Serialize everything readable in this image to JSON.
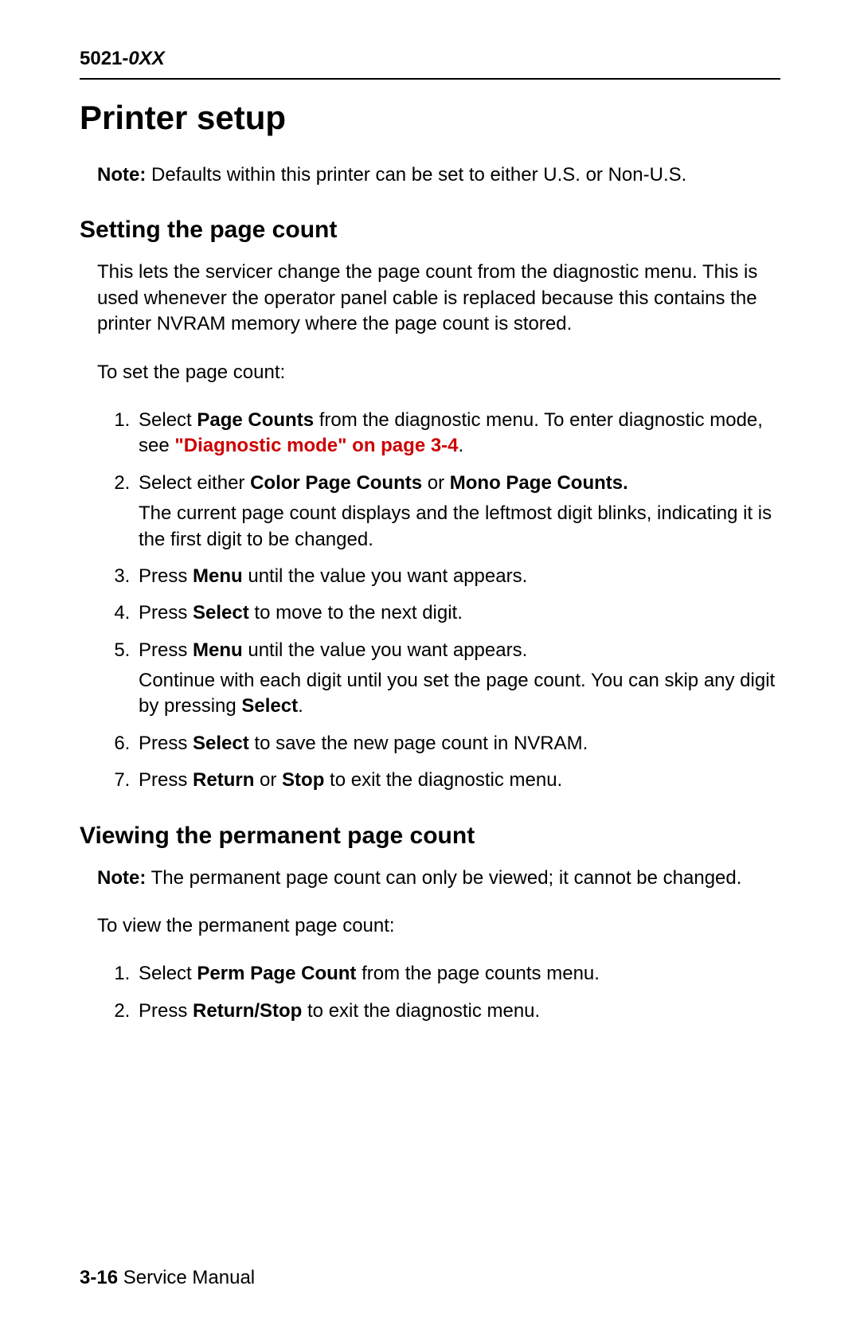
{
  "header": {
    "model_prefix": "5021-",
    "model_suffix": "0XX"
  },
  "main": {
    "title": "Printer setup",
    "note_bold": "Note:",
    "note_text": "  Defaults within this printer can be set to either U.S. or Non-U.S.",
    "section1": {
      "title": "Setting the page count",
      "intro": "This lets the servicer change the page count from the diagnostic menu. This is used whenever the operator panel cable is replaced because this contains the printer NVRAM memory where the page count is stored.",
      "lead": "To set the page count:",
      "steps": {
        "s1_a": "Select ",
        "s1_b": "Page Counts",
        "s1_c": " from the diagnostic menu. To enter diagnostic mode, see ",
        "s1_link": "\"Diagnostic mode\" on page 3-4",
        "s1_d": ".",
        "s2_a": "Select either ",
        "s2_b": "Color Page Counts",
        "s2_c": " or ",
        "s2_d": "Mono Page Counts.",
        "s2_sub": "The current page count displays and the leftmost digit blinks, indicating it is the first digit to be changed.",
        "s3_a": "Press ",
        "s3_b": "Menu",
        "s3_c": " until the value you want appears.",
        "s4_a": "Press ",
        "s4_b": "Select",
        "s4_c": " to move to the next digit.",
        "s5_a": "Press ",
        "s5_b": "Menu",
        "s5_c": " until the value you want appears.",
        "s5_sub_a": "Continue with each digit until you set the page count. You can skip any digit by pressing ",
        "s5_sub_b": "Select",
        "s5_sub_c": ".",
        "s6_a": "Press ",
        "s6_b": "Select",
        "s6_c": " to save the new page count in NVRAM.",
        "s7_a": "Press ",
        "s7_b": "Return",
        "s7_c": " or ",
        "s7_d": "Stop",
        "s7_e": " to exit the diagnostic menu."
      }
    },
    "section2": {
      "title": "Viewing the permanent page count",
      "note_bold": "Note:",
      "note_text": "  The permanent page count can only be viewed; it cannot be changed.",
      "lead": "To view the permanent page count:",
      "steps": {
        "s1_a": "Select ",
        "s1_b": "Perm Page Count",
        "s1_c": " from the page counts menu.",
        "s2_a": "Press ",
        "s2_b": "Return/Stop",
        "s2_c": " to exit the diagnostic menu."
      }
    }
  },
  "footer": {
    "page": "3-16",
    "label": "  Service Manual"
  }
}
